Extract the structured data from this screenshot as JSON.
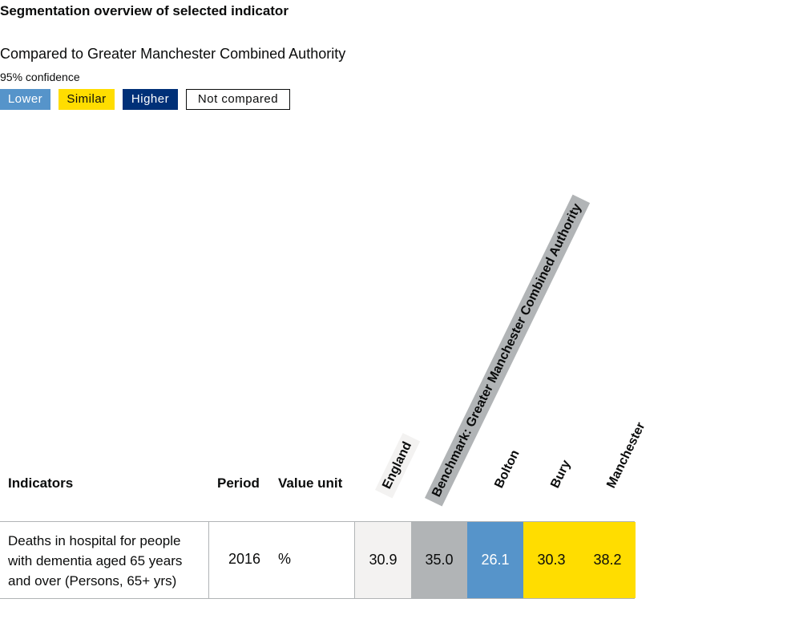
{
  "title": "Segmentation overview of selected indicator",
  "compared_to": "Compared to Greater Manchester Combined Authority",
  "confidence": "95% confidence",
  "legend": {
    "lower": "Lower",
    "similar": "Similar",
    "higher": "Higher",
    "not_compared": "Not compared"
  },
  "colors": {
    "lower": "#5694ca",
    "similar": "#ffdd00",
    "higher": "#003078",
    "england": "#f3f2f1",
    "benchmark": "#b1b4b6"
  },
  "table": {
    "headers": {
      "indicators": "Indicators",
      "period": "Period",
      "value_unit": "Value unit"
    },
    "areas": [
      {
        "name": "England",
        "value": "30.9"
      },
      {
        "name": "Benchmark: Greater Manchester Combined Authority",
        "value": "35.0"
      },
      {
        "name": "Bolton",
        "value": "26.1",
        "comparison": "Lower"
      },
      {
        "name": "Bury",
        "value": "30.3",
        "comparison": "Similar"
      },
      {
        "name": "Manchester",
        "value": "38.2",
        "comparison": "Similar"
      }
    ],
    "row": {
      "indicator": "Deaths in hospital for people with dementia aged 65 years and over (Persons, 65+ yrs)",
      "period": "2016",
      "unit": "%"
    }
  }
}
